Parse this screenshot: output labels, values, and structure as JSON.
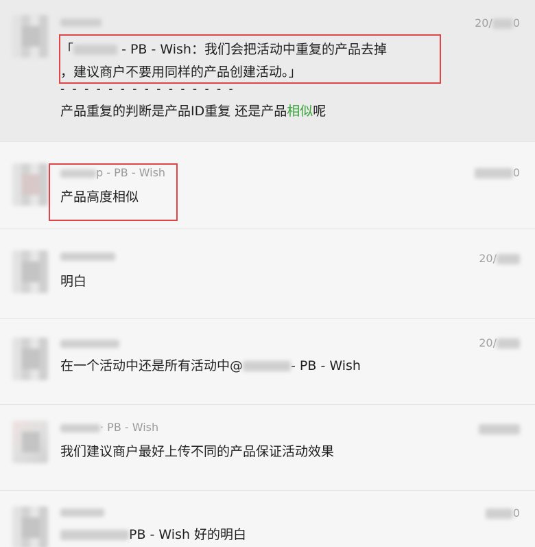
{
  "messages": [
    {
      "sender_visible": "",
      "time_prefix": "20/",
      "time_suffix": "0",
      "quote_line1": "- PB - Wish：我们会把活动中重复的产品去掉",
      "quote_line2": "，建议商户不要用同样的产品创建活动。」",
      "dashes": "- - - - - - - - - - - - - - -",
      "text_before": "产品重复的判断是产品ID重复 还是产品",
      "text_highlight": "相似",
      "text_after": "呢"
    },
    {
      "sender_visible": "p - PB - Wish",
      "time_prefix": "",
      "time_suffix": "0",
      "text": "产品高度相似"
    },
    {
      "sender_visible": "",
      "time_prefix": "20/",
      "time_suffix": "",
      "text": "明白"
    },
    {
      "sender_visible": "",
      "time_prefix": "20/",
      "time_suffix": "",
      "text_before": "在一个活动中还是所有活动中@",
      "text_after": "- PB - Wish"
    },
    {
      "sender_visible": "· PB - Wish",
      "time_prefix": "",
      "time_suffix": "",
      "text": "我们建议商户最好上传不同的产品保证活动效果"
    },
    {
      "sender_visible": "",
      "time_prefix": "",
      "time_suffix": "0",
      "text": "PB - Wish 好的明白"
    }
  ],
  "colors": {
    "highlight_box": "#e04444",
    "keyword_green": "#3aa23a",
    "selected_row_bg": "#ebebeb"
  }
}
